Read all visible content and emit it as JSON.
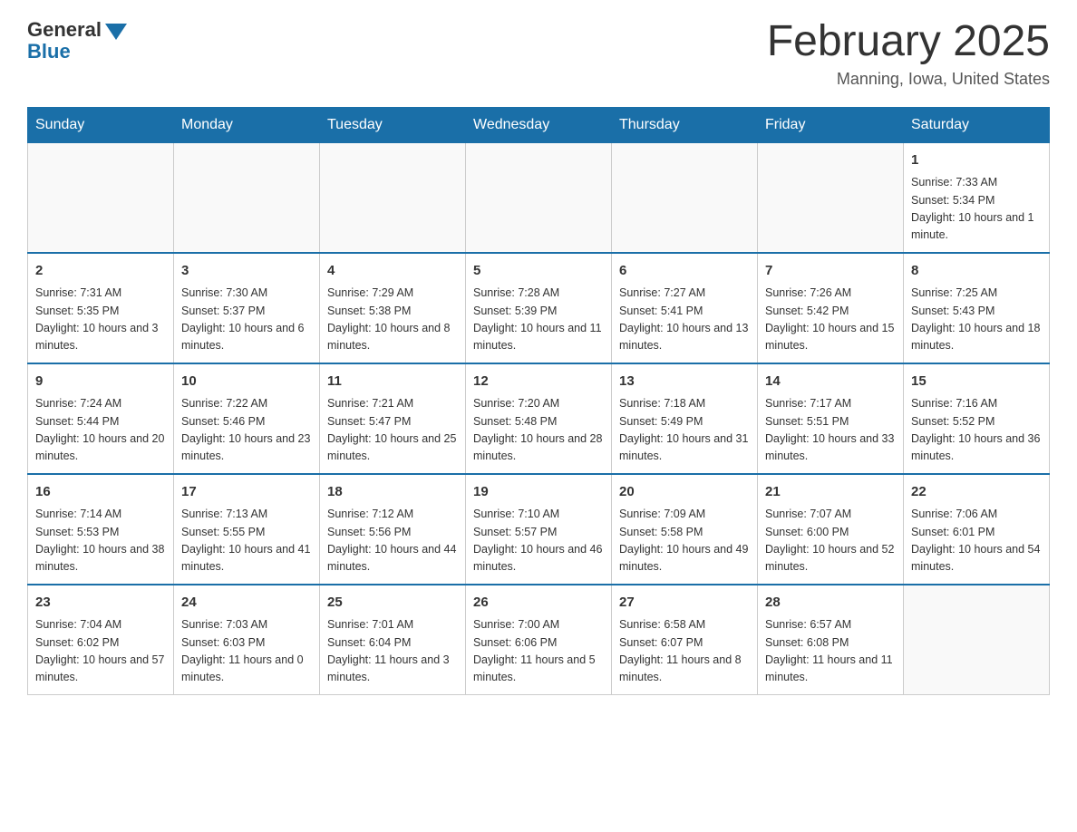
{
  "header": {
    "logo_general": "General",
    "logo_blue": "Blue",
    "title": "February 2025",
    "location": "Manning, Iowa, United States"
  },
  "days_of_week": [
    "Sunday",
    "Monday",
    "Tuesday",
    "Wednesday",
    "Thursday",
    "Friday",
    "Saturday"
  ],
  "weeks": [
    [
      {
        "day": "",
        "info": ""
      },
      {
        "day": "",
        "info": ""
      },
      {
        "day": "",
        "info": ""
      },
      {
        "day": "",
        "info": ""
      },
      {
        "day": "",
        "info": ""
      },
      {
        "day": "",
        "info": ""
      },
      {
        "day": "1",
        "info": "Sunrise: 7:33 AM\nSunset: 5:34 PM\nDaylight: 10 hours and 1 minute."
      }
    ],
    [
      {
        "day": "2",
        "info": "Sunrise: 7:31 AM\nSunset: 5:35 PM\nDaylight: 10 hours and 3 minutes."
      },
      {
        "day": "3",
        "info": "Sunrise: 7:30 AM\nSunset: 5:37 PM\nDaylight: 10 hours and 6 minutes."
      },
      {
        "day": "4",
        "info": "Sunrise: 7:29 AM\nSunset: 5:38 PM\nDaylight: 10 hours and 8 minutes."
      },
      {
        "day": "5",
        "info": "Sunrise: 7:28 AM\nSunset: 5:39 PM\nDaylight: 10 hours and 11 minutes."
      },
      {
        "day": "6",
        "info": "Sunrise: 7:27 AM\nSunset: 5:41 PM\nDaylight: 10 hours and 13 minutes."
      },
      {
        "day": "7",
        "info": "Sunrise: 7:26 AM\nSunset: 5:42 PM\nDaylight: 10 hours and 15 minutes."
      },
      {
        "day": "8",
        "info": "Sunrise: 7:25 AM\nSunset: 5:43 PM\nDaylight: 10 hours and 18 minutes."
      }
    ],
    [
      {
        "day": "9",
        "info": "Sunrise: 7:24 AM\nSunset: 5:44 PM\nDaylight: 10 hours and 20 minutes."
      },
      {
        "day": "10",
        "info": "Sunrise: 7:22 AM\nSunset: 5:46 PM\nDaylight: 10 hours and 23 minutes."
      },
      {
        "day": "11",
        "info": "Sunrise: 7:21 AM\nSunset: 5:47 PM\nDaylight: 10 hours and 25 minutes."
      },
      {
        "day": "12",
        "info": "Sunrise: 7:20 AM\nSunset: 5:48 PM\nDaylight: 10 hours and 28 minutes."
      },
      {
        "day": "13",
        "info": "Sunrise: 7:18 AM\nSunset: 5:49 PM\nDaylight: 10 hours and 31 minutes."
      },
      {
        "day": "14",
        "info": "Sunrise: 7:17 AM\nSunset: 5:51 PM\nDaylight: 10 hours and 33 minutes."
      },
      {
        "day": "15",
        "info": "Sunrise: 7:16 AM\nSunset: 5:52 PM\nDaylight: 10 hours and 36 minutes."
      }
    ],
    [
      {
        "day": "16",
        "info": "Sunrise: 7:14 AM\nSunset: 5:53 PM\nDaylight: 10 hours and 38 minutes."
      },
      {
        "day": "17",
        "info": "Sunrise: 7:13 AM\nSunset: 5:55 PM\nDaylight: 10 hours and 41 minutes."
      },
      {
        "day": "18",
        "info": "Sunrise: 7:12 AM\nSunset: 5:56 PM\nDaylight: 10 hours and 44 minutes."
      },
      {
        "day": "19",
        "info": "Sunrise: 7:10 AM\nSunset: 5:57 PM\nDaylight: 10 hours and 46 minutes."
      },
      {
        "day": "20",
        "info": "Sunrise: 7:09 AM\nSunset: 5:58 PM\nDaylight: 10 hours and 49 minutes."
      },
      {
        "day": "21",
        "info": "Sunrise: 7:07 AM\nSunset: 6:00 PM\nDaylight: 10 hours and 52 minutes."
      },
      {
        "day": "22",
        "info": "Sunrise: 7:06 AM\nSunset: 6:01 PM\nDaylight: 10 hours and 54 minutes."
      }
    ],
    [
      {
        "day": "23",
        "info": "Sunrise: 7:04 AM\nSunset: 6:02 PM\nDaylight: 10 hours and 57 minutes."
      },
      {
        "day": "24",
        "info": "Sunrise: 7:03 AM\nSunset: 6:03 PM\nDaylight: 11 hours and 0 minutes."
      },
      {
        "day": "25",
        "info": "Sunrise: 7:01 AM\nSunset: 6:04 PM\nDaylight: 11 hours and 3 minutes."
      },
      {
        "day": "26",
        "info": "Sunrise: 7:00 AM\nSunset: 6:06 PM\nDaylight: 11 hours and 5 minutes."
      },
      {
        "day": "27",
        "info": "Sunrise: 6:58 AM\nSunset: 6:07 PM\nDaylight: 11 hours and 8 minutes."
      },
      {
        "day": "28",
        "info": "Sunrise: 6:57 AM\nSunset: 6:08 PM\nDaylight: 11 hours and 11 minutes."
      },
      {
        "day": "",
        "info": ""
      }
    ]
  ]
}
